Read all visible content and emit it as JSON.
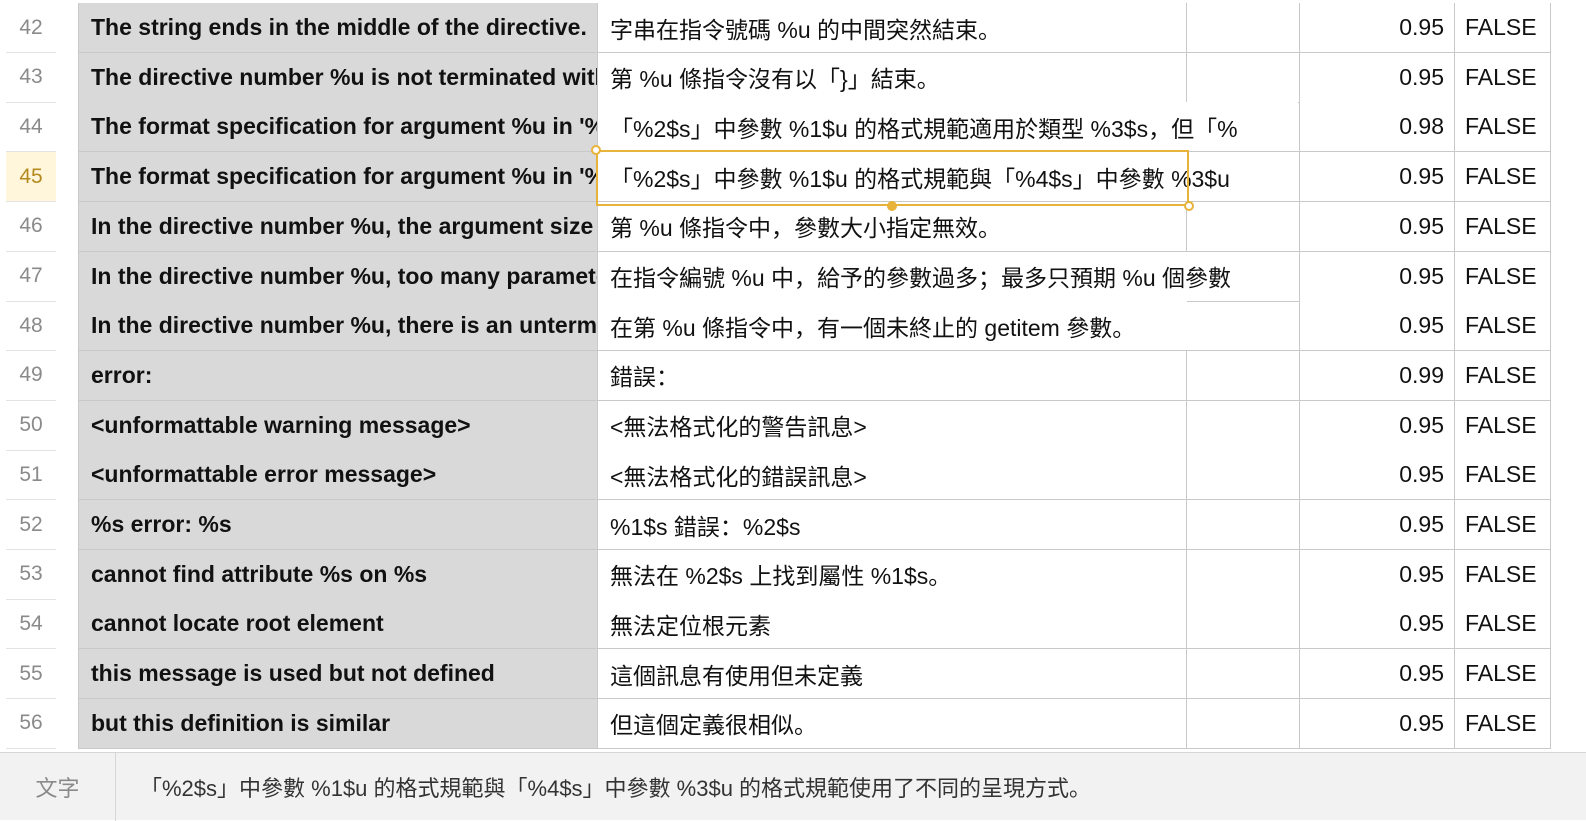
{
  "rows": [
    {
      "num": "42",
      "source": "The string ends in the middle of the directive.",
      "translation": "字串在指令號碼 %u 的中間突然結束。",
      "extra": "",
      "score": "0.95",
      "flag": "FALSE"
    },
    {
      "num": "43",
      "source": "The directive number %u is not terminated with '}'.",
      "translation": "第 %u 條指令沒有以「}」結束。",
      "extra": "",
      "score": "0.95",
      "flag": "FALSE"
    },
    {
      "num": "44",
      "source": "The format specification for argument %u in '%s'",
      "translation": "「%2$s」中參數 %1$u 的格式規範適用於類型 %3$s，但「%",
      "extra": "",
      "score": "0.98",
      "flag": "FALSE"
    },
    {
      "num": "45",
      "source": "The format specification for argument %u in '%s'",
      "translation": "「%2$s」中參數 %1$u 的格式規範與「%4$s」中參數 %3$u",
      "extra": "",
      "score": "0.95",
      "flag": "FALSE"
    },
    {
      "num": "46",
      "source": "In the directive number %u, the argument size",
      "translation": "第 %u 條指令中，參數大小指定無效。",
      "extra": "",
      "score": "0.95",
      "flag": "FALSE"
    },
    {
      "num": "47",
      "source": "In the directive number %u, too many parameters",
      "translation": "在指令編號 %u 中，給予的參數過多；最多只預期 %u 個參數",
      "extra": "",
      "score": "0.95",
      "flag": "FALSE"
    },
    {
      "num": "48",
      "source": "In the directive number %u, there is an unterminated",
      "translation": "在第 %u 條指令中，有一個未終止的 getitem 參數。",
      "extra": "",
      "score": "0.95",
      "flag": "FALSE"
    },
    {
      "num": "49",
      "source": "error:",
      "translation": "錯誤：",
      "extra": "",
      "score": "0.99",
      "flag": "FALSE"
    },
    {
      "num": "50",
      "source": "<unformattable warning message>",
      "translation": "<無法格式化的警告訊息>",
      "extra": "",
      "score": "0.95",
      "flag": "FALSE"
    },
    {
      "num": "51",
      "source": "<unformattable error message>",
      "translation": "<無法格式化的錯誤訊息>",
      "extra": "",
      "score": "0.95",
      "flag": "FALSE"
    },
    {
      "num": "52",
      "source": "%s error: %s",
      "translation": "%1$s 錯誤：%2$s",
      "extra": "",
      "score": "0.95",
      "flag": "FALSE"
    },
    {
      "num": "53",
      "source": "cannot find attribute %s on %s",
      "translation": "無法在 %2$s 上找到屬性 %1$s。",
      "extra": "",
      "score": "0.95",
      "flag": "FALSE"
    },
    {
      "num": "54",
      "source": "cannot locate root element",
      "translation": "無法定位根元素",
      "extra": "",
      "score": "0.95",
      "flag": "FALSE"
    },
    {
      "num": "55",
      "source": "this message is used but not defined",
      "translation": "這個訊息有使用但未定義",
      "extra": "",
      "score": "0.95",
      "flag": "FALSE"
    },
    {
      "num": "56",
      "source": "but this definition is similar",
      "translation": "但這個定義很相似。",
      "extra": "",
      "score": "0.95",
      "flag": "FALSE"
    }
  ],
  "active_row": "45",
  "formula_bar": {
    "label": "文字",
    "content": "「%2$s」中參數 %1$u 的格式規範與「%4$s」中參數 %3$u 的格式規範使用了不同的呈現方式。"
  },
  "colors": {
    "selection": "#e8b33b",
    "source_column_bg": "#d9d9d9",
    "active_row_header_bg": "#fff6dc"
  }
}
